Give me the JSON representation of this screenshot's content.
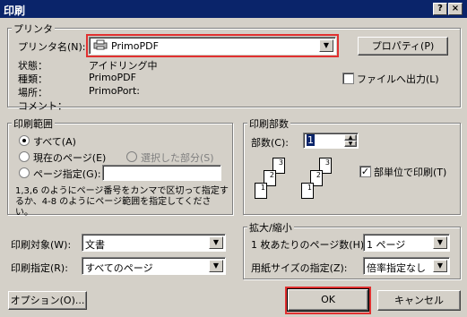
{
  "window": {
    "title": "印刷",
    "help_btn": "?",
    "close_btn": "×"
  },
  "printer": {
    "group_label": "プリンタ",
    "name_label": "プリンタ名(N):",
    "name_value": "PrimoPDF",
    "properties_btn": "プロパティ(P)",
    "status_label": "状態：",
    "status_value": "アイドリング中",
    "type_label": "種類：",
    "type_value": "PrimoPDF",
    "where_label": "場所：",
    "where_value": "PrimoPort:",
    "comment_label": "コメント：",
    "print_to_file_label": "ファイルへ出力(L)"
  },
  "range": {
    "group_label": "印刷範囲",
    "all_label": "すべて(A)",
    "current_label": "現在のページ(E)",
    "selection_label": "選択した部分(S)",
    "pages_label": "ページ指定(G):",
    "pages_value": "",
    "hint": "1,3,6 のようにページ番号をカンマで区切って指定するか、4-8 のようにページ範囲を指定してください。"
  },
  "copies": {
    "group_label": "印刷部数",
    "count_label": "部数(C):",
    "count_value": "1",
    "collate_label": "部単位で印刷(T)",
    "page_nums": [
      "3",
      "2",
      "1",
      "3",
      "2",
      "1"
    ]
  },
  "print_what": {
    "label": "印刷対象(W):",
    "value": "文書"
  },
  "print_mode": {
    "label": "印刷指定(R):",
    "value": "すべてのページ"
  },
  "zoom": {
    "group_label": "拡大/縮小",
    "pps_label": "1 枚あたりのページ数(H):",
    "pps_value": "1 ページ",
    "paper_label": "用紙サイズの指定(Z):",
    "paper_value": "倍率指定なし"
  },
  "buttons": {
    "options": "オプション(O)...",
    "ok": "OK",
    "cancel": "キャンセル"
  },
  "colors": {
    "titlebar": "#0a246a",
    "face": "#d4d0c8",
    "highlight": "#e03030"
  }
}
